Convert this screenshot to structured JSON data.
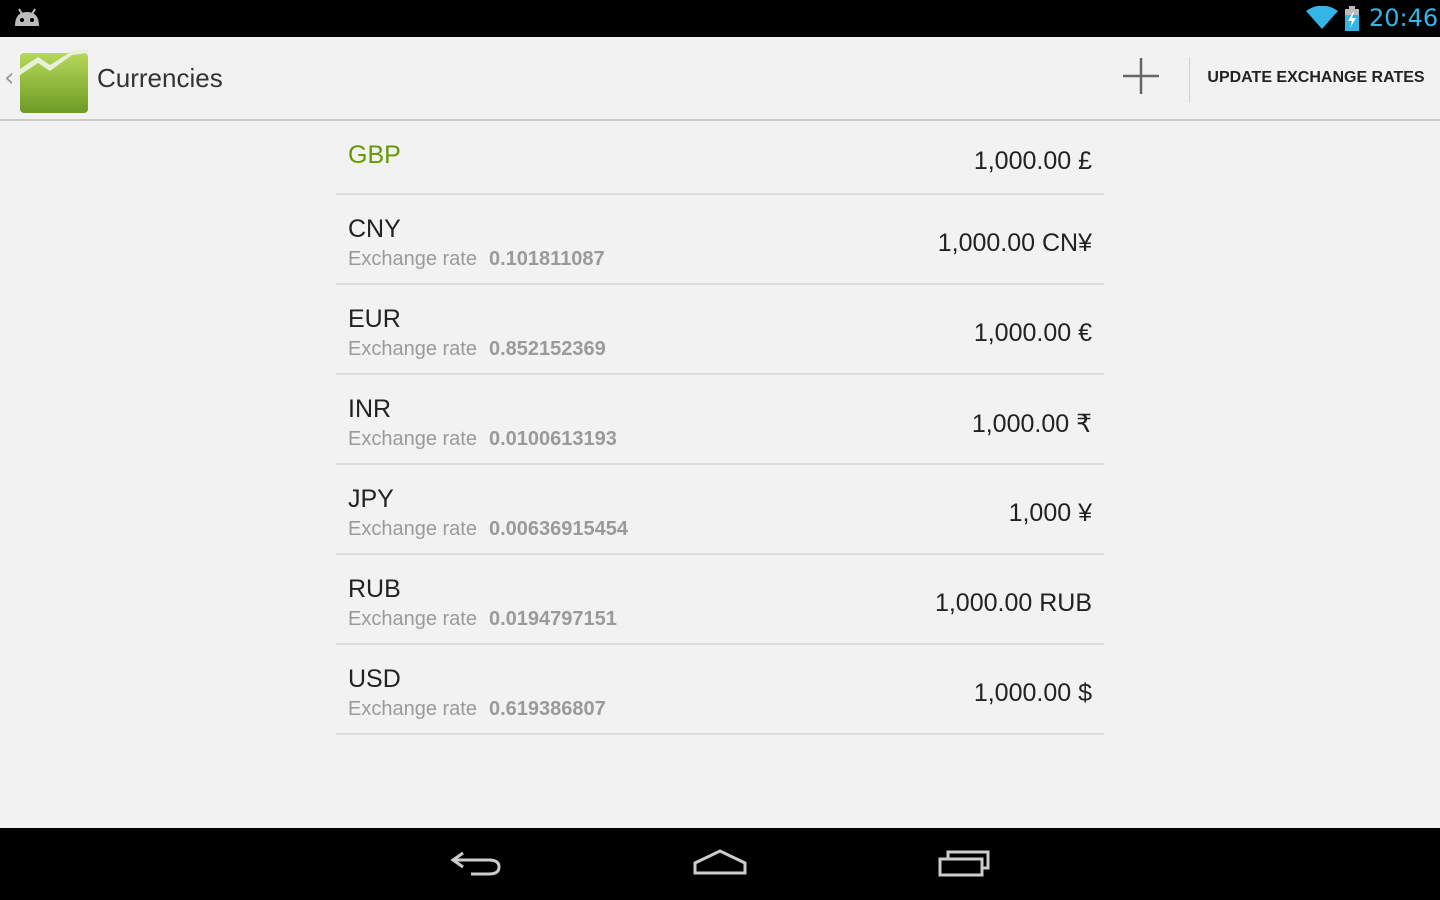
{
  "status_bar": {
    "time": "20:46",
    "icons": [
      "android-icon",
      "wifi-icon",
      "battery-charging-icon"
    ]
  },
  "action_bar": {
    "title": "Currencies",
    "add_icon": "plus-icon",
    "update_label": "UPDATE EXCHANGE RATES"
  },
  "rate_label": "Exchange rate",
  "currencies": [
    {
      "code": "GBP",
      "amount": "1,000.00 £",
      "rate": ""
    },
    {
      "code": "CNY",
      "amount": "1,000.00 CN¥",
      "rate": "0.101811087"
    },
    {
      "code": "EUR",
      "amount": "1,000.00 €",
      "rate": "0.852152369"
    },
    {
      "code": "INR",
      "amount": "1,000.00 ₹",
      "rate": "0.0100613193"
    },
    {
      "code": "JPY",
      "amount": "1,000 ¥",
      "rate": "0.00636915454"
    },
    {
      "code": "RUB",
      "amount": "1,000.00 RUB",
      "rate": "0.0194797151"
    },
    {
      "code": "USD",
      "amount": "1,000.00 $",
      "rate": "0.619386807"
    }
  ],
  "colors": {
    "base_currency": "#669900",
    "clock": "#33b5e5",
    "background": "#f2f2f2"
  },
  "nav_bar": {
    "buttons": [
      "back-icon",
      "home-icon",
      "recents-icon"
    ]
  }
}
